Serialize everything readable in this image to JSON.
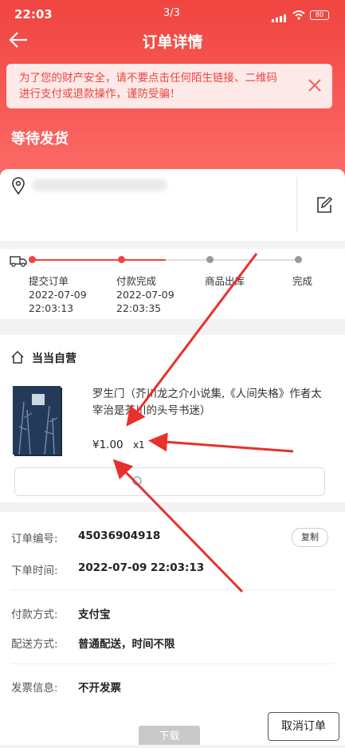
{
  "status_bar": {
    "time": "22:03",
    "page_indicator": "3/3",
    "battery": "80"
  },
  "header": {
    "title": "订单详情"
  },
  "notice": {
    "text": "为了您的财产安全，请不要点击任何陌生链接、二维码进行支付或退款操作，谨防受骗！"
  },
  "order_state": "等待发货",
  "address": {
    "masked": ""
  },
  "progress": {
    "steps": [
      {
        "label": "提交订单",
        "date": "2022-07-09",
        "time": "22:03:13"
      },
      {
        "label": "付款完成",
        "date": "2022-07-09",
        "time": "22:03:35"
      },
      {
        "label": "商品出库",
        "date": "",
        "time": ""
      },
      {
        "label": "完成",
        "date": "",
        "time": ""
      }
    ],
    "completed": 2
  },
  "shop": {
    "name": "当当自营",
    "item": {
      "name": "罗生门（芥川龙之介小说集,《人间失格》作者太宰治是芥川的头号书迷）",
      "price": "¥1.00",
      "qty": "x1"
    }
  },
  "order_info": {
    "order_no_label": "订单编号:",
    "order_no": "45036904918",
    "copy_label": "复制",
    "time_label": "下单时间:",
    "time": "2022-07-09 22:03:13",
    "pay_label": "付款方式:",
    "pay": "支付宝",
    "ship_label": "配送方式:",
    "ship": "普通配送，时间不限",
    "invoice_label": "发票信息:",
    "invoice": "不开发票"
  },
  "bottom": {
    "download": "下载",
    "cancel": "取消订单"
  },
  "colors": {
    "brand_red": "#f0443f",
    "arrow_red": "#e8302c"
  }
}
